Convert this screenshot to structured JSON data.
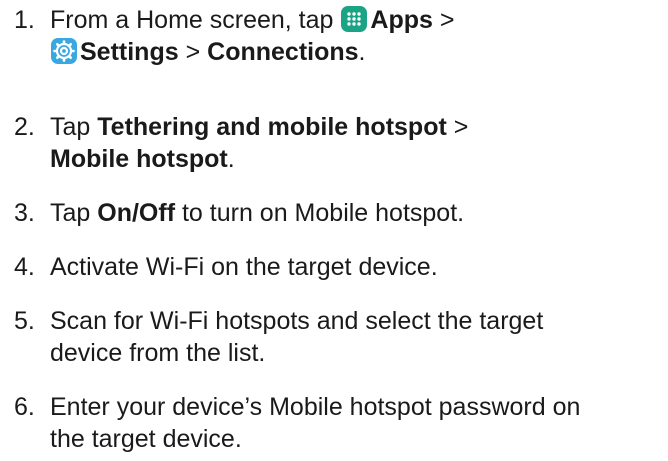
{
  "steps": [
    {
      "number": "1.",
      "pre": "From a Home screen, tap",
      "apps_label": "Apps",
      "sep1": ">",
      "settings_label": "Settings",
      "sep2": ">",
      "connections_label": "Connections",
      "end": "."
    },
    {
      "number": "2.",
      "pre": "Tap",
      "bold1": "Tethering and mobile hotspot",
      "sep": ">",
      "bold2": "Mobile hotspot",
      "end": "."
    },
    {
      "number": "3.",
      "pre": "Tap",
      "bold": "On/Off",
      "post": "to turn on Mobile hotspot."
    },
    {
      "number": "4.",
      "line1": "Activate Wi-Fi on the target device."
    },
    {
      "number": "5.",
      "line1": "Scan for Wi-Fi hotspots and select the target",
      "line2": "device from the list."
    },
    {
      "number": "6.",
      "line1": "Enter your device’s Mobile hotspot password on",
      "line2": "the target device."
    }
  ],
  "icons": {
    "apps": "apps-grid-icon",
    "settings": "settings-gear-icon"
  },
  "colors": {
    "apps_icon_bg": "#1aa385",
    "settings_icon_bg": "#39a8e0",
    "text": "#1a1a1a"
  }
}
